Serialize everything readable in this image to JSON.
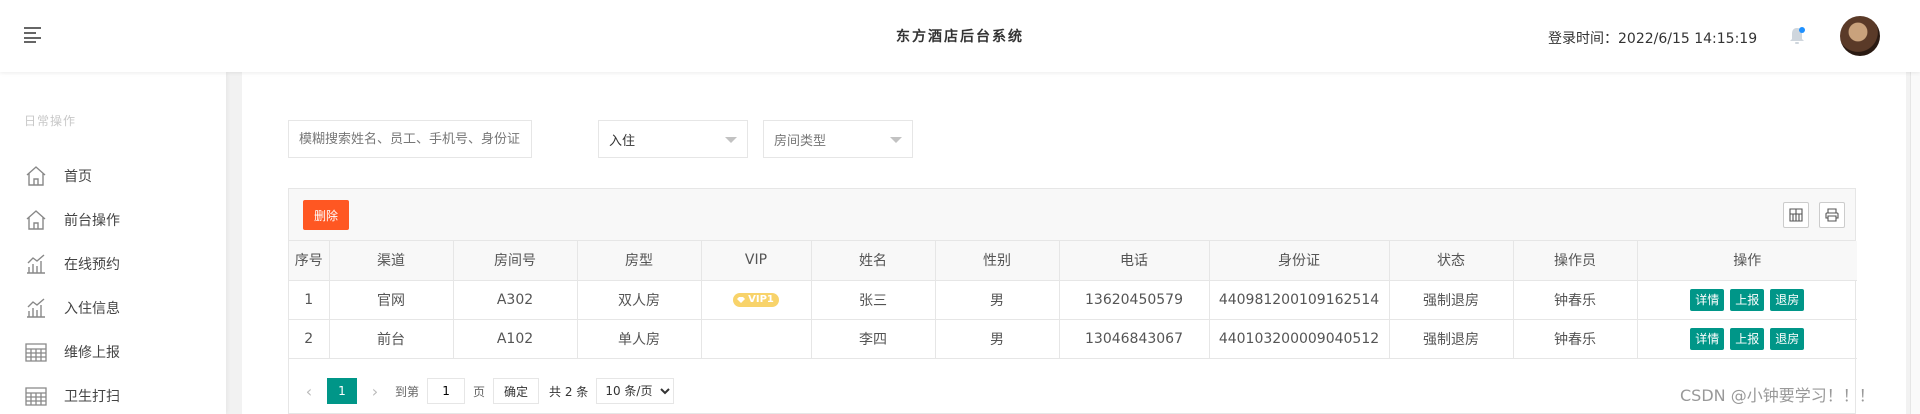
{
  "header": {
    "title": "东方酒店后台系统",
    "login_time_label": "登录时间：2022/6/15 14:15:19"
  },
  "sidebar": {
    "heading": "日常操作",
    "items": [
      {
        "label": "首页",
        "icon": "home-icon"
      },
      {
        "label": "前台操作",
        "icon": "home-icon"
      },
      {
        "label": "在线预约",
        "icon": "chart-icon"
      },
      {
        "label": "入住信息",
        "icon": "chart-icon"
      },
      {
        "label": "维修上报",
        "icon": "calendar-icon"
      },
      {
        "label": "卫生打扫",
        "icon": "calendar-icon"
      }
    ]
  },
  "filters": {
    "search_placeholder": "模糊搜索姓名、员工、手机号、身份证",
    "status_value": "入住",
    "room_type_placeholder": "房间类型"
  },
  "toolbar": {
    "delete_label": "删除",
    "icons": [
      "columns-icon",
      "print-icon"
    ]
  },
  "table": {
    "columns": [
      "序号",
      "渠道",
      "房间号",
      "房型",
      "VIP",
      "姓名",
      "性别",
      "电话",
      "身份证",
      "状态",
      "操作员",
      "操作"
    ],
    "rows": [
      {
        "index": "1",
        "channel": "官网",
        "room": "A302",
        "type": "双人房",
        "vip": "VIP1",
        "name": "张三",
        "gender": "男",
        "phone": "13620450579",
        "id_card": "440981200109162514",
        "status": "强制退房",
        "operator": "钟春乐"
      },
      {
        "index": "2",
        "channel": "前台",
        "room": "A102",
        "type": "单人房",
        "vip": "",
        "name": "李四",
        "gender": "男",
        "phone": "13046843067",
        "id_card": "440103200009040512",
        "status": "强制退房",
        "operator": "钟春乐"
      }
    ],
    "actions": [
      "详情",
      "上报",
      "退房"
    ]
  },
  "pager": {
    "current_page": "1",
    "goto_prefix": "到第",
    "goto_value": "1",
    "goto_suffix": "页",
    "confirm_label": "确定",
    "total_label": "共 2 条",
    "page_size": "10 条/页"
  },
  "watermark": "CSDN @小钟要学习！！！",
  "colors": {
    "accent": "#009688",
    "danger": "#ff5722",
    "vip": "#f8d36a",
    "notification_dot": "#1e90ff"
  }
}
